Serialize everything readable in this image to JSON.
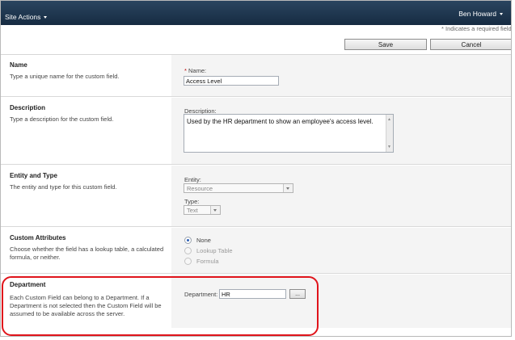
{
  "header": {
    "site_actions_label": "Site Actions",
    "user_name": "Ben Howard"
  },
  "required_note": "* Indicates a required field",
  "toolbar": {
    "save_label": "Save",
    "cancel_label": "Cancel"
  },
  "sections": {
    "name": {
      "title": "Name",
      "description": "Type a unique name for the custom field.",
      "field_label": "Name:",
      "required_marker": "*",
      "value": "Access Level"
    },
    "description": {
      "title": "Description",
      "description": "Type a description for the custom field.",
      "field_label": "Description:",
      "value": "Used by the HR department to show an employee's access level."
    },
    "entity_type": {
      "title": "Entity and Type",
      "description": "The entity and type for this custom field.",
      "entity_label": "Entity:",
      "entity_value": "Resource",
      "type_label": "Type:",
      "type_value": "Text"
    },
    "custom_attributes": {
      "title": "Custom Attributes",
      "description": "Choose whether the field has a lookup table, a calculated formula, or neither.",
      "options": [
        "None",
        "Lookup Table",
        "Formula"
      ],
      "selected": "None"
    },
    "department": {
      "title": "Department",
      "description": "Each Custom Field can belong to a Department. If a Department is not selected then the Custom Field will be assumed to be available across the server.",
      "field_label": "Department:",
      "value": "HR",
      "browse_label": "..."
    }
  },
  "colors": {
    "header_bg": "#1f3a55",
    "highlight": "#e0141b"
  }
}
